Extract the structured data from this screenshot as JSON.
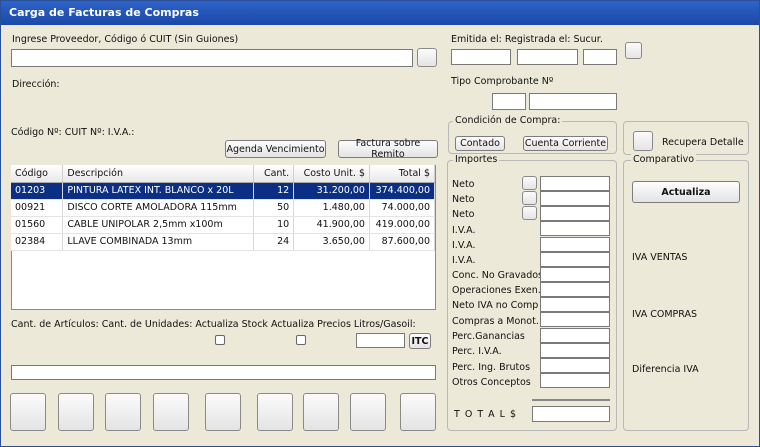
{
  "window": {
    "title": "Carga de Facturas de Compras"
  },
  "proveedor": {
    "label": "Ingrese Proveedor, Código ó CUIT (Sin Guiones)",
    "value": ""
  },
  "direccion_label": "Dirección:",
  "codigo_line": "Código Nº: CUIT Nº: I.V.A.:",
  "top_right": {
    "emitida_label": "Emitida el: Registrada el: Sucur.",
    "tipo_label": "Tipo Comprobante Nº"
  },
  "buttons": {
    "agenda": "Agenda Vencimiento",
    "remito": "Factura sobre Remito",
    "contado": "Contado",
    "cuenta_corriente": "Cuenta Corriente",
    "recupera": "Recupera Detalle",
    "actualiza": "Actualiza",
    "itc": "ITC"
  },
  "groups": {
    "condicion": "Condición de Compra:",
    "importes": "Importes",
    "comparativo": "Comparativo"
  },
  "table": {
    "headers": [
      "Código",
      "Descripción",
      "Cant.",
      "Costo Unit. $",
      "Total $"
    ],
    "rows": [
      [
        "01203",
        "PINTURA LATEX INT. BLANCO x 20L",
        "12",
        "31.200,00",
        "374.400,00"
      ],
      [
        "00921",
        "DISCO CORTE AMOLADORA 115mm",
        "50",
        "1.480,00",
        "74.000,00"
      ],
      [
        "01560",
        "CABLE UNIPOLAR 2,5mm x100m",
        "10",
        "41.900,00",
        "419.000,00"
      ],
      [
        "02384",
        "LLAVE COMBINADA 13mm",
        "24",
        "3.650,00",
        "87.600,00"
      ]
    ]
  },
  "bottom_line": "Cant. de Artículos: Cant. de Unidades: Actualiza Stock Actualiza Precios Litros/Gasoil:",
  "importes": [
    "Neto",
    "Neto",
    "Neto",
    "I.V.A.",
    "I.V.A.",
    "I.V.A.",
    "Conc. No Gravados",
    "Operaciones Exen.",
    "Neto IVA no Comp",
    "Compras a Monot.",
    "Perc.Ganancias",
    "Perc. I.V.A.",
    "Perc. Ing. Brutos",
    "Otros Conceptos"
  ],
  "total_label": "T O T A L $",
  "comparativo": {
    "iva_ventas": "IVA VENTAS",
    "iva_compras": "IVA COMPRAS",
    "diferencia": "Diferencia IVA"
  }
}
